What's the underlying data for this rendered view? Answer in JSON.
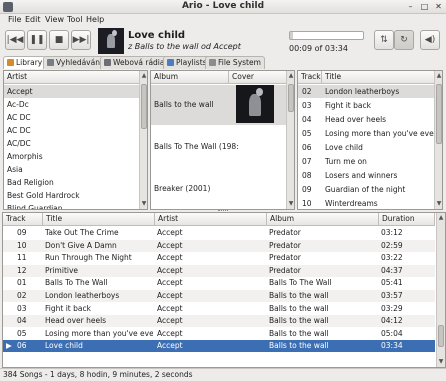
{
  "window": {
    "title": "Ario - Love child"
  },
  "menu": [
    "File",
    "Edit",
    "View",
    "Tool",
    "Help"
  ],
  "toolbar": {
    "buttons": [
      "previous-icon",
      "pause-icon",
      "stop-icon",
      "next-icon"
    ],
    "right_buttons": [
      "repeat-icon",
      "random-icon",
      "volume-icon"
    ]
  },
  "now_playing": {
    "title": "Love child",
    "subtitle": "z Balls to the wall od Accept",
    "elapsed_label": "00:09 of 03:34",
    "progress": 0.04
  },
  "tabs": [
    "Library",
    "Vyhledávání",
    "Webová rádia",
    "Playlists",
    "File System"
  ],
  "library": {
    "artist_header": "Artist",
    "artists": [
      "Accept",
      "Ac-Dc",
      "AC DC",
      "AC DC",
      "AC/DC",
      "Amorphis",
      "Asia",
      "Bad Religion",
      "Best Gold Hardrock",
      "Blind Guardian"
    ],
    "album_header": "Album",
    "cover_header": "Cover",
    "albums": [
      "Balls to the wall",
      "Balls To The Wall (198:",
      "Breaker (2001)"
    ],
    "track_header": "Track",
    "title_header": "Title",
    "tracks": [
      {
        "track": "02",
        "title": "London leatherboys"
      },
      {
        "track": "03",
        "title": "Fight it back"
      },
      {
        "track": "04",
        "title": "Head over heels"
      },
      {
        "track": "05",
        "title": "Losing more than you've ever h"
      },
      {
        "track": "06",
        "title": "Love child"
      },
      {
        "track": "07",
        "title": "Turn me on"
      },
      {
        "track": "08",
        "title": "Losers and winners"
      },
      {
        "track": "09",
        "title": "Guardian of the night"
      },
      {
        "track": "10",
        "title": "Winterdreams"
      }
    ]
  },
  "playlist": {
    "headers": [
      "Track",
      "Title",
      "Artist",
      "Album",
      "Duration"
    ],
    "rows": [
      [
        "09",
        "Take Out The Crime",
        "Accept",
        "Predator",
        "03:12"
      ],
      [
        "10",
        "Don't Give A Damn",
        "Accept",
        "Predator",
        "02:59"
      ],
      [
        "11",
        "Run Through The Night",
        "Accept",
        "Predator",
        "03:22"
      ],
      [
        "12",
        "Primitive",
        "Accept",
        "Predator",
        "04:37"
      ],
      [
        "01",
        "Balls To The Wall",
        "Accept",
        "Balls To The Wall",
        "05:41"
      ],
      [
        "02",
        "London leatherboys",
        "Accept",
        "Balls to the wall",
        "03:57"
      ],
      [
        "03",
        "Fight it back",
        "Accept",
        "Balls to the wall",
        "03:29"
      ],
      [
        "04",
        "Head over heels",
        "Accept",
        "Balls to the wall",
        "04:12"
      ],
      [
        "05",
        "Losing more than you've ever h",
        "Accept",
        "Balls to the wall",
        "05:04"
      ],
      [
        "06",
        "Love child",
        "Accept",
        "Balls to the wall",
        "03:34"
      ]
    ]
  },
  "status": "384 Songs - 1 days, 8 hodin, 9 minutes, 2 seconds"
}
